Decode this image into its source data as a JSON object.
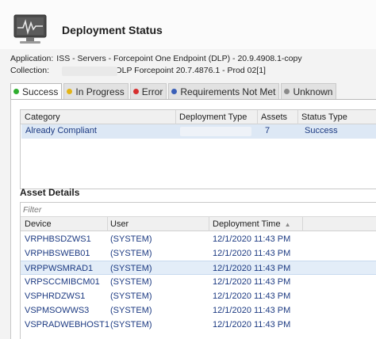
{
  "header": {
    "title": "Deployment Status",
    "icon": "monitor-heartbeat-icon",
    "application_label": "Application:",
    "application_value": "ISS - Servers - Forcepoint One Endpoint (DLP) - 20.9.4908.1-copy",
    "collection_label": "Collection:",
    "collection_value": "DLP Forcepoint 20.7.4876.1 - Prod 02[1]"
  },
  "tabs": [
    {
      "label": "Success",
      "color": "#2fae2f",
      "active": true
    },
    {
      "label": "In Progress",
      "color": "#e3b416",
      "active": false
    },
    {
      "label": "Error",
      "color": "#d62f2f",
      "active": false
    },
    {
      "label": "Requirements Not Met",
      "color": "#3a5fb8",
      "active": false
    },
    {
      "label": "Unknown",
      "color": "#8a8a8a",
      "active": false
    }
  ],
  "summary": {
    "columns": [
      "Category",
      "Deployment Type",
      "Assets",
      "Status Type"
    ],
    "rows": [
      {
        "category": "Already Compliant",
        "deployment_type": "",
        "assets": "7",
        "status_type": "Success"
      }
    ]
  },
  "asset_details": {
    "title": "Asset Details",
    "filter_placeholder": "Filter",
    "columns": [
      "Device",
      "User",
      "Deployment Time"
    ],
    "rows": [
      {
        "device": "VRPHBSDZWS1",
        "user": "(SYSTEM)",
        "time": "12/1/2020 11:43 PM"
      },
      {
        "device": "VRPHBSWEB01",
        "user": "(SYSTEM)",
        "time": "12/1/2020 11:43 PM"
      },
      {
        "device": "VRPPWSMRAD1",
        "user": "(SYSTEM)",
        "time": "12/1/2020 11:43 PM"
      },
      {
        "device": "VRPSCCMIBCM01",
        "user": "(SYSTEM)",
        "time": "12/1/2020 11:43 PM"
      },
      {
        "device": "VSPHRDZWS1",
        "user": "(SYSTEM)",
        "time": "12/1/2020 11:43 PM"
      },
      {
        "device": "VSPMSOWWS3",
        "user": "(SYSTEM)",
        "time": "12/1/2020 11:43 PM"
      },
      {
        "device": "VSPRADWEBHOST1",
        "user": "(SYSTEM)",
        "time": "12/1/2020 11:43 PM"
      }
    ]
  }
}
